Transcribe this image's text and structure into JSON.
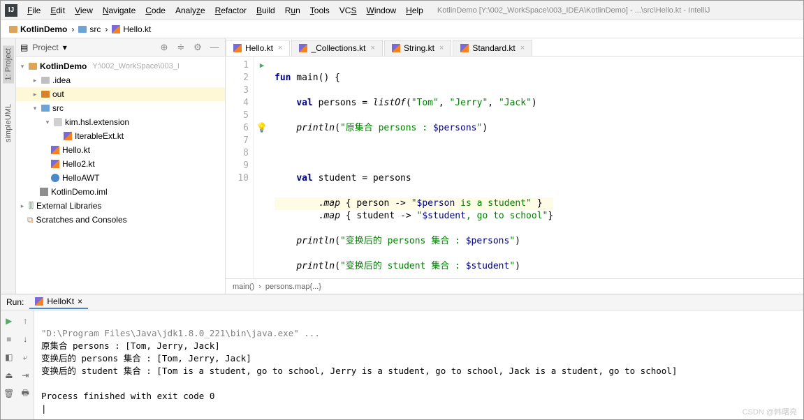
{
  "window_title": "KotlinDemo [Y:\\002_WorkSpace\\003_IDEA\\KotlinDemo] - ...\\src\\Hello.kt - IntelliJ",
  "menu": [
    "File",
    "Edit",
    "View",
    "Navigate",
    "Code",
    "Analyze",
    "Refactor",
    "Build",
    "Run",
    "Tools",
    "VCS",
    "Window",
    "Help"
  ],
  "breadcrumbs": [
    "KotlinDemo",
    "src",
    "Hello.kt"
  ],
  "left_labels": [
    "1: Project",
    "simpleUML"
  ],
  "sidebar": {
    "title": "Project",
    "tree": {
      "root": "KotlinDemo",
      "root_path": "Y:\\002_WorkSpace\\003_I",
      "idea": ".idea",
      "out": "out",
      "src": "src",
      "pkg": "kim.hsl.extension",
      "iterable": "IterableExt.kt",
      "hello": "Hello.kt",
      "hello2": "Hello2.kt",
      "helloawt": "HelloAWT",
      "iml": "KotlinDemo.iml",
      "ext": "External Libraries",
      "scratch": "Scratches and Consoles"
    }
  },
  "tabs": [
    {
      "label": "Hello.kt",
      "active": true
    },
    {
      "label": "_Collections.kt",
      "active": false
    },
    {
      "label": "String.kt",
      "active": false
    },
    {
      "label": "Standard.kt",
      "active": false
    }
  ],
  "code": {
    "l1a": "fun",
    "l1b": " main() {",
    "l2a": "    ",
    "l2b": "val",
    "l2c": " persons = ",
    "l2d": "listOf",
    "l2e": "(",
    "l2f": "\"Tom\"",
    "l2g": ", ",
    "l2h": "\"Jerry\"",
    "l2i": ", ",
    "l2j": "\"Jack\"",
    "l2k": ")",
    "l3a": "    ",
    "l3b": "println",
    "l3c": "(",
    "l3d": "\"原集合 persons : ",
    "l3e": "$persons",
    "l3f": "\"",
    "l3g": ")",
    "l5a": "    ",
    "l5b": "val",
    "l5c": " student = persons",
    "l6a": "        .",
    "l6b": "map",
    "l6c": " { person -> ",
    "l6d": "\"",
    "l6e": "$person",
    "l6f": " is a student\"",
    "l6g": " }",
    "l7a": "        .",
    "l7b": "map",
    "l7c": " { student -> ",
    "l7d": "\"",
    "l7e": "$student",
    "l7f": ", go to school\"",
    "l7g": "}",
    "l8a": "    ",
    "l8b": "println",
    "l8c": "(",
    "l8d": "\"变换后的 persons 集合 : ",
    "l8e": "$persons",
    "l8f": "\"",
    "l8g": ")",
    "l9a": "    ",
    "l9b": "println",
    "l9c": "(",
    "l9d": "\"变换后的 student 集合 : ",
    "l9e": "$student",
    "l9f": "\"",
    "l9g": ")",
    "l10": "}"
  },
  "line_numbers": [
    "1",
    "2",
    "3",
    "4",
    "5",
    "6",
    "7",
    "8",
    "9",
    "10"
  ],
  "editor_crumbs": [
    "main()",
    "persons.map{...}"
  ],
  "run": {
    "label": "Run:",
    "tab": "HelloKt",
    "out1": "\"D:\\Program Files\\Java\\jdk1.8.0_221\\bin\\java.exe\" ...",
    "out2": "原集合 persons : [Tom, Jerry, Jack]",
    "out3": "变换后的 persons 集合 : [Tom, Jerry, Jack]",
    "out4": "变换后的 student 集合 : [Tom is a student, go to school, Jerry is a student, go to school, Jack is a student, go to school]",
    "out5": "",
    "out6": "Process finished with exit code 0"
  },
  "watermark": "CSDN @韩曙亮"
}
